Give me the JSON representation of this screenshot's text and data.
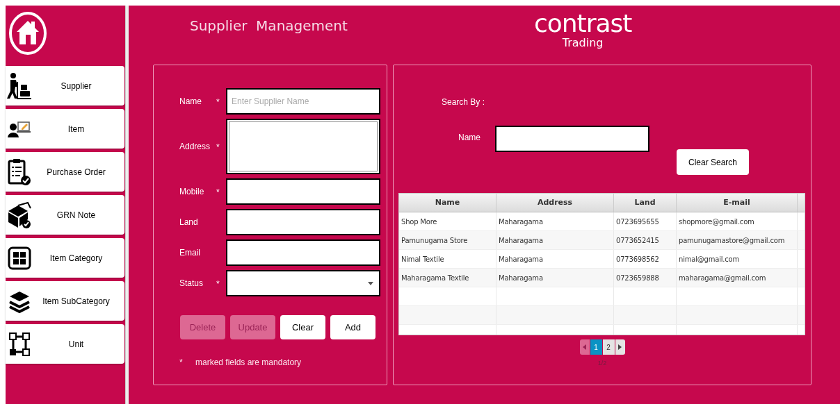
{
  "sidebar": {
    "items": [
      {
        "label": "Supplier",
        "kind": "supplier"
      },
      {
        "label": "Item",
        "kind": "item"
      },
      {
        "label": "Purchase Order",
        "kind": "order"
      },
      {
        "label": "GRN Note",
        "kind": "grn"
      },
      {
        "label": "Item Category",
        "kind": "category"
      },
      {
        "label": "Item SubCategory",
        "kind": "subcategory"
      },
      {
        "label": "Unit",
        "kind": "unit"
      }
    ]
  },
  "header": {
    "title": "Supplier  Management",
    "logo": {
      "name": "contrast",
      "tagline": "Trading"
    }
  },
  "form": {
    "fields": [
      {
        "label": "Name",
        "required": true,
        "kind": "text",
        "placeholder": "Enter Supplier Name"
      },
      {
        "label": "Address",
        "required": true,
        "kind": "textarea"
      },
      {
        "label": "Mobile",
        "required": true,
        "kind": "text"
      },
      {
        "label": "Land",
        "required": false,
        "kind": "text"
      },
      {
        "label": "Email",
        "required": false,
        "kind": "text"
      },
      {
        "label": "Status",
        "required": true,
        "kind": "select"
      }
    ],
    "buttons": [
      {
        "label": "Delete",
        "disabled": true
      },
      {
        "label": "Update",
        "disabled": true
      },
      {
        "label": "Clear",
        "disabled": false
      },
      {
        "label": "Add",
        "disabled": false
      }
    ],
    "note": {
      "mark": "*",
      "text": "marked fields are mandatory"
    }
  },
  "search": {
    "heading": "Search By :",
    "label": "Name",
    "clear_button": "Clear Search"
  },
  "table": {
    "columns": [
      "Name",
      "Address",
      "Land",
      "E-mail"
    ],
    "rows": [
      [
        "Shop More",
        "Maharagama",
        "0723695655",
        "shopmore@gmail.com"
      ],
      [
        "Pamunugama Store",
        "Maharagama",
        "0773652415",
        "pamunugamastore@gmail.com"
      ],
      [
        "Nimal Textile",
        "Maharagama",
        "0773698562",
        "nimal@gmail.com"
      ],
      [
        "Maharagama Textile",
        "Maharagama",
        "0723659888",
        "maharagama@gmail.com"
      ]
    ]
  },
  "pagination": {
    "prev_disabled": true,
    "next_disabled": false,
    "pages": [
      {
        "label": "1",
        "selected": true
      },
      {
        "label": "2",
        "selected": false
      }
    ],
    "counter": "1/2"
  }
}
